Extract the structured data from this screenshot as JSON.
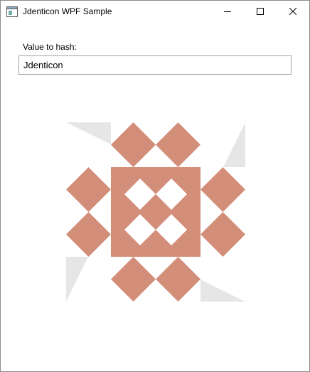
{
  "window": {
    "title": "Jdenticon WPF Sample",
    "app_icon": "window-app-icon",
    "caption_buttons": [
      "minimize-icon",
      "maximize-icon",
      "close-icon"
    ]
  },
  "form": {
    "label": "Value to hash:",
    "input_value": "Jdenticon"
  },
  "identicon": {
    "colors": {
      "primary": "#d38e7a",
      "secondary": "#e6e6e6",
      "background": "#ffffff"
    }
  }
}
